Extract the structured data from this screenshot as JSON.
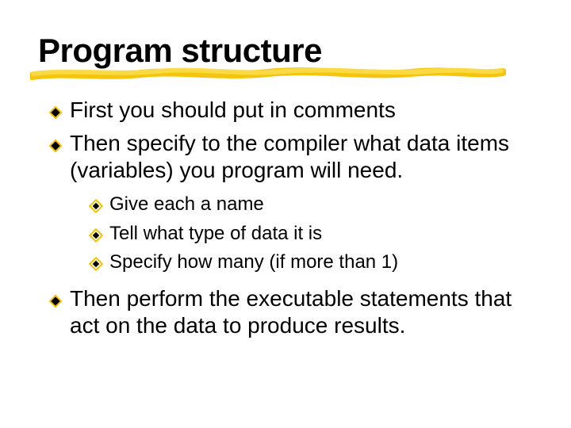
{
  "slide": {
    "title": "Program structure",
    "bullets": [
      {
        "text": "First you should put in comments"
      },
      {
        "text": "Then specify to the compiler what data items (variables) you program will need.",
        "sub": [
          "Give each a name",
          "Tell what type of data it is",
          "Specify how many (if more than 1)"
        ]
      },
      {
        "text": "Then perform the executable statements that act on the data to produce results."
      }
    ]
  },
  "colors": {
    "highlight": "#f4c200",
    "highlight_light": "#f9da4a"
  }
}
